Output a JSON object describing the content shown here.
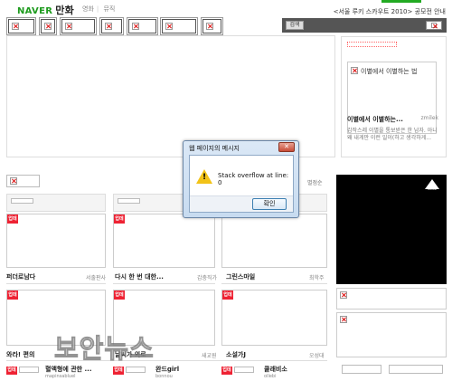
{
  "header": {
    "logo": "NAVER",
    "section": "만화",
    "nav": [
      "영화",
      "뮤직"
    ],
    "promo": "<서울 루키 스카우트 2010> 공모전 안내"
  },
  "rightbar": {
    "label": "검색"
  },
  "sidebox": {
    "ad_text": "이별에서 이별하는 법",
    "title": "이별에서 이별하는...",
    "author": "zmilek",
    "desc": "갑작스레 이별을 통보받은 한 남자. 아니 왜 내게만 이런 일이(하고 생각하게..."
  },
  "sort_label": "별점순",
  "cards_row1": [
    {
      "badge": "업데",
      "title": "퍼더로남다",
      "author": "서출판사"
    },
    {
      "badge": "업데",
      "title": "다시 한 번 대한...",
      "author": "갑충직가"
    },
    {
      "badge": "업데",
      "title": "그린스마일",
      "author": "최학주"
    }
  ],
  "cards_row2": [
    {
      "badge": "업데",
      "title": "와라! 편의",
      "author": ""
    },
    {
      "badge": "업데",
      "title": "날씨가 외로",
      "author": "새교원"
    },
    {
      "badge": "업데",
      "title": "소설가J",
      "author": "오성대"
    }
  ],
  "bottom_row": [
    {
      "badge": "업데",
      "title": "혈액형에 관한 ...",
      "sub": "mapinsabluel"
    },
    {
      "badge": "업데",
      "title": "완드girl",
      "sub": "bonnou"
    },
    {
      "badge": "업데",
      "title": "쿨래비소",
      "sub": "ollebi"
    }
  ],
  "watermark": "보안뉴스",
  "dialog": {
    "title": "웹 페이지의 메시지",
    "close": "✕",
    "message": "Stack overflow at line: 0",
    "ok": "확인"
  },
  "blackpanel": {
    "logo_text": "Adobe"
  },
  "colors": {
    "naver_green": "#1e9b1e",
    "badge_red": "#e22233",
    "dialog_border": "#6b86a6"
  }
}
